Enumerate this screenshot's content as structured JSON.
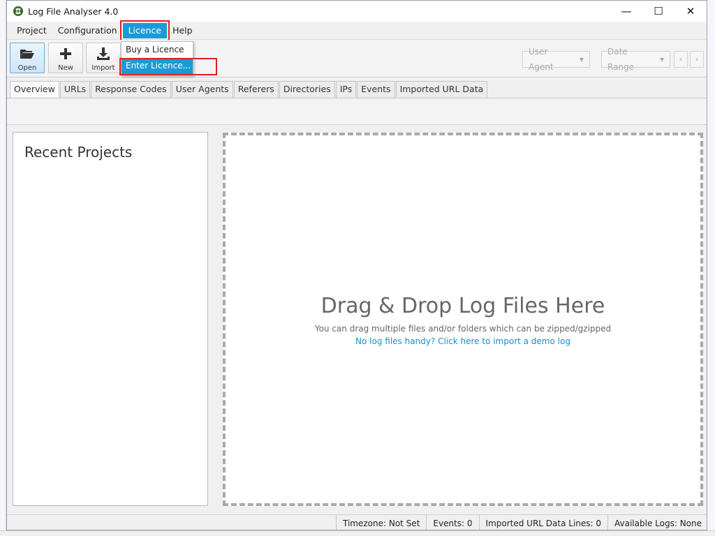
{
  "window": {
    "title": "Log File Analyser 4.0",
    "controls": {
      "minimize": "—",
      "maximize": "☐",
      "close": "✕"
    }
  },
  "menu": {
    "items": [
      "Project",
      "Configuration",
      "Licence",
      "Help"
    ],
    "active": "Licence",
    "dropdown": [
      "Buy a Licence",
      "Enter Licence..."
    ],
    "dropdown_selected": "Enter Licence..."
  },
  "toolbar": {
    "open_label": "Open",
    "new_label": "New",
    "import_label": "Import",
    "user_agent": "User Agent",
    "date_range": "Date Range",
    "prev": "‹",
    "next": "›"
  },
  "tabs": {
    "items": [
      "Overview",
      "URLs",
      "Response Codes",
      "User Agents",
      "Referers",
      "Directories",
      "IPs",
      "Events",
      "Imported URL Data"
    ],
    "active": "Overview"
  },
  "recent": {
    "title": "Recent Projects"
  },
  "dropzone": {
    "title": "Drag & Drop Log Files Here",
    "subtitle": "You can drag multiple files and/or folders which can be zipped/gzipped",
    "link": "No log files handy? Click here to import a demo log"
  },
  "status": {
    "timezone": "Timezone:  Not Set",
    "events": "Events:  0",
    "imported": "Imported URL Data Lines:  0",
    "available": "Available Logs:  None"
  },
  "colors": {
    "accent": "#1a9bd7",
    "highlight_box": "#e02020",
    "link": "#1a8ec9"
  }
}
